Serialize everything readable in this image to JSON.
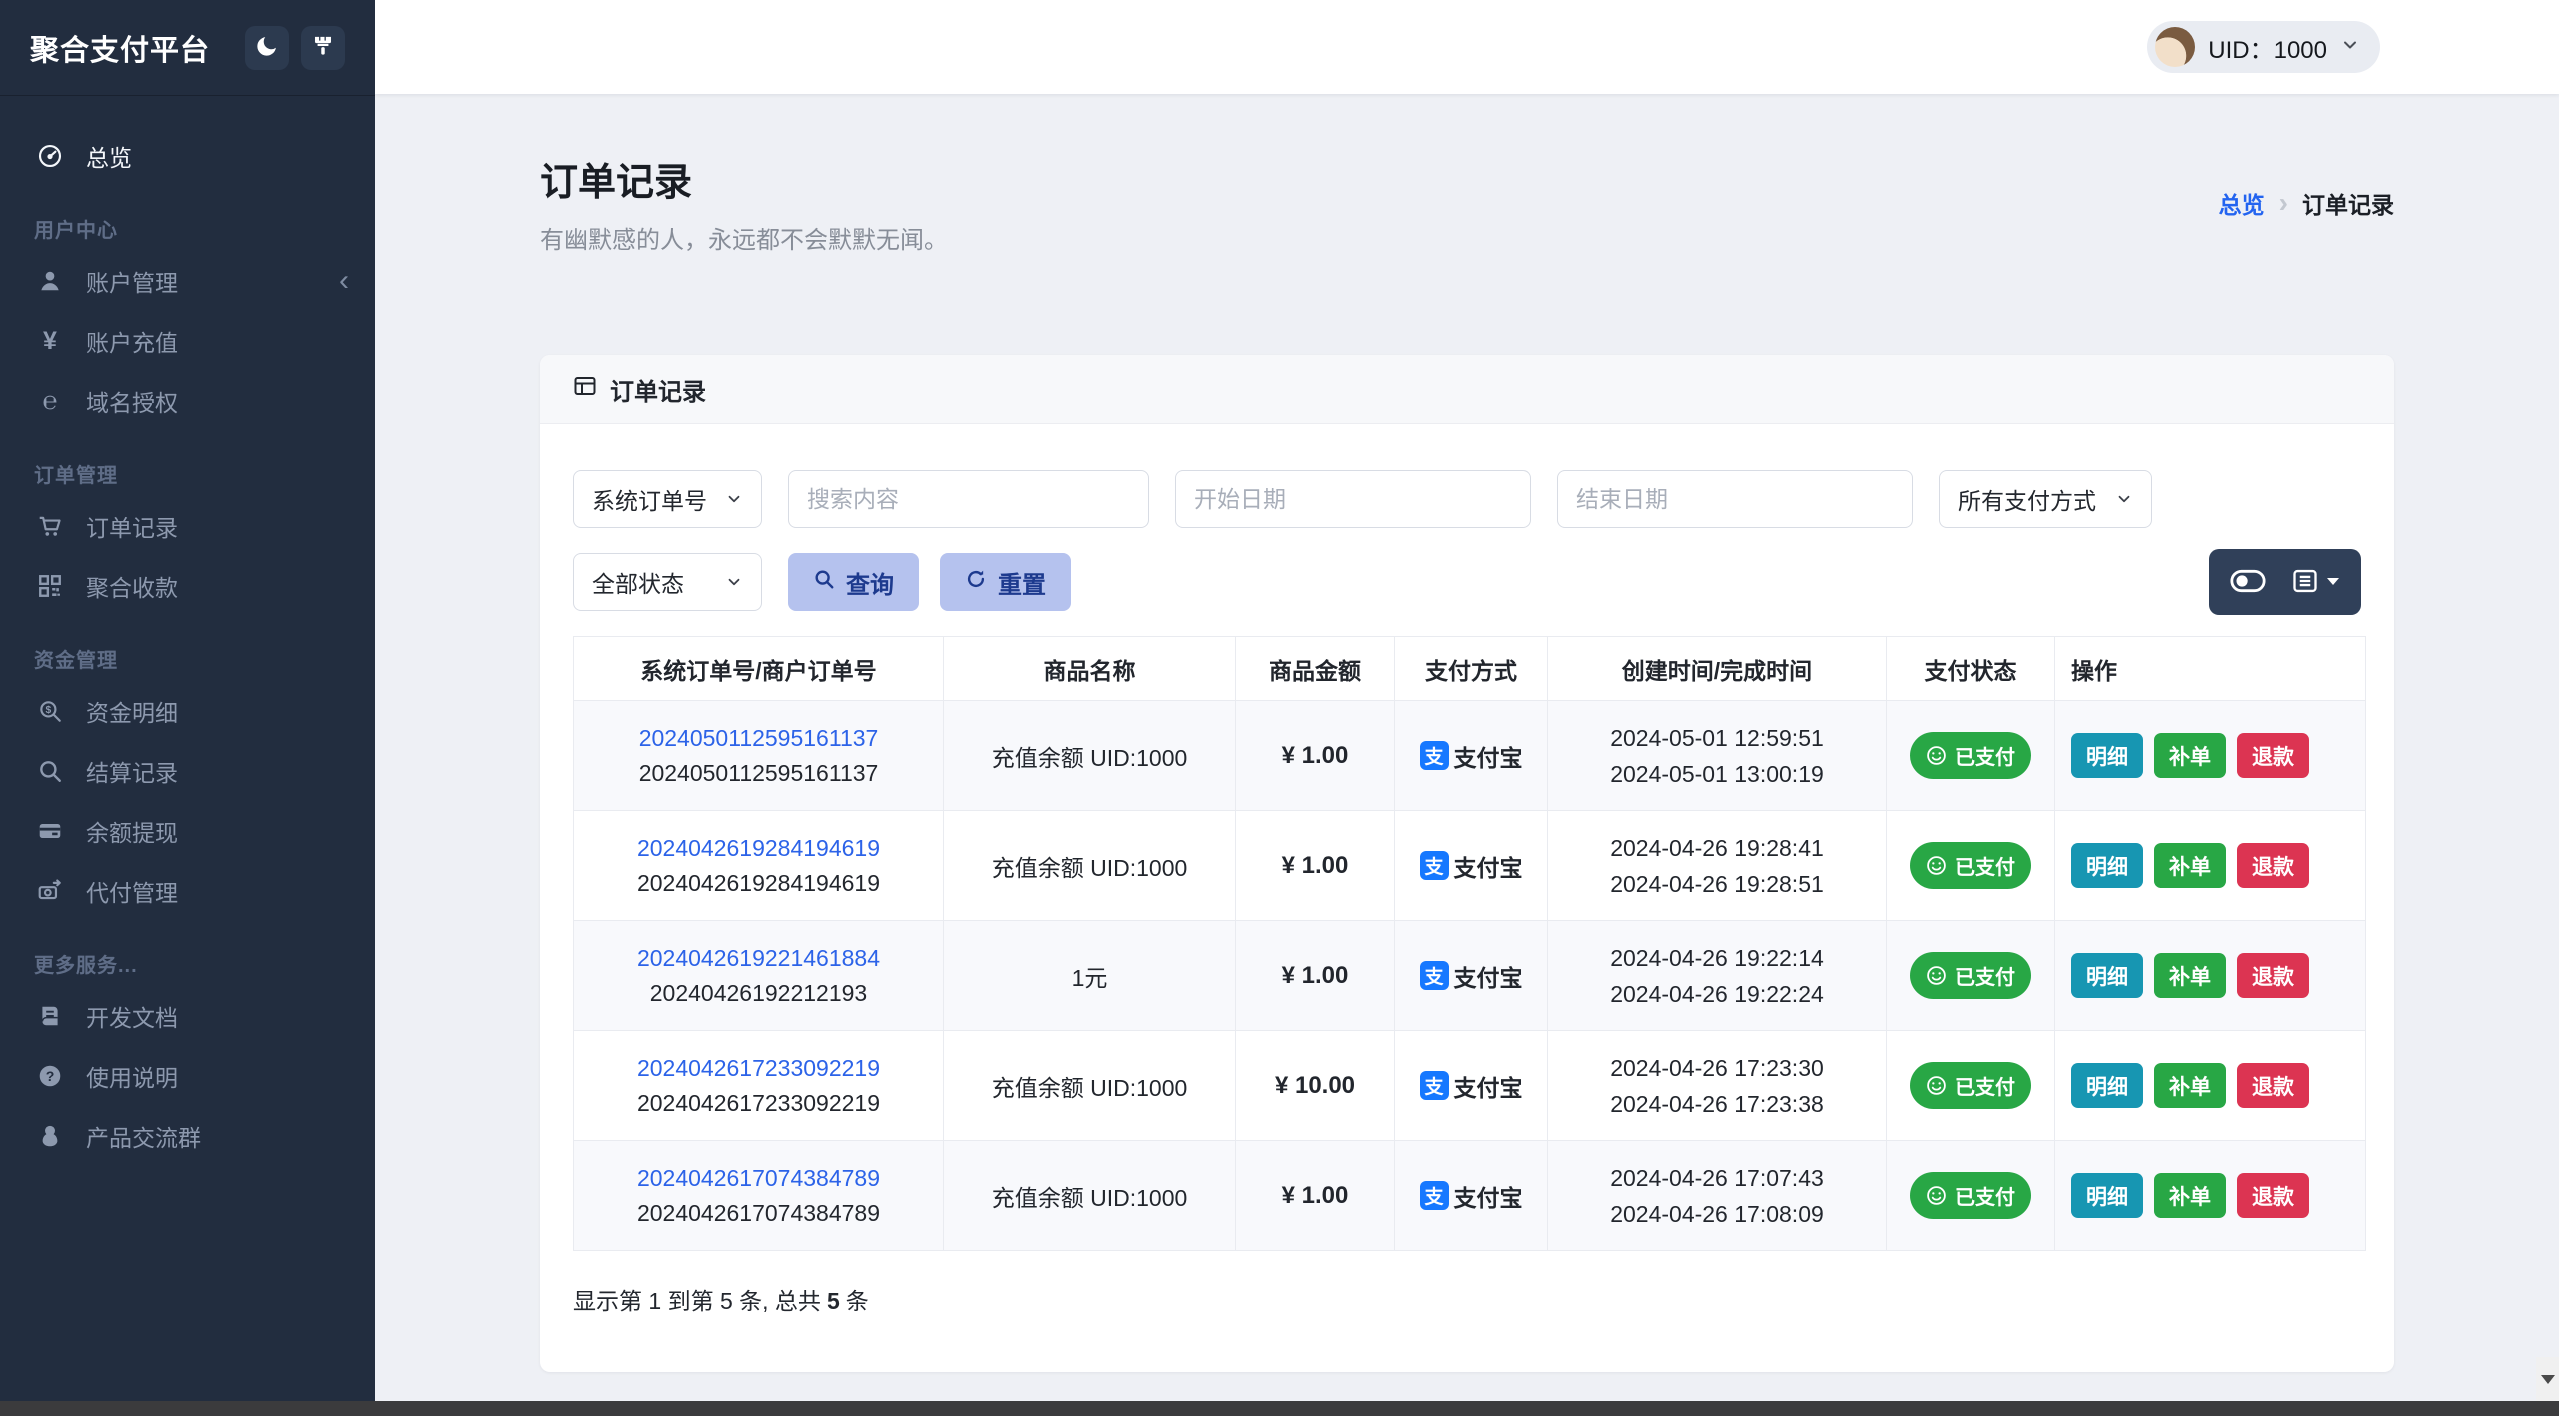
{
  "app": {
    "title": "聚合支付平台"
  },
  "topbar": {
    "uid": "UID：1000"
  },
  "icons": {
    "yen_glyph": "¥",
    "globe_glyph": "℮",
    "alipay_glyph": "支"
  },
  "sidebar": {
    "overview": "总览",
    "sections": [
      {
        "title": "用户中心",
        "items": [
          "账户管理",
          "账户充值",
          "域名授权"
        ]
      },
      {
        "title": "订单管理",
        "items": [
          "订单记录",
          "聚合收款"
        ]
      },
      {
        "title": "资金管理",
        "items": [
          "资金明细",
          "结算记录",
          "余额提现",
          "代付管理"
        ]
      },
      {
        "title": "更多服务...",
        "items": [
          "开发文档",
          "使用说明",
          "产品交流群"
        ]
      }
    ]
  },
  "page": {
    "title": "订单记录",
    "subtitle": "有幽默感的人，永远都不会默默无闻。",
    "breadcrumb": {
      "home": "总览",
      "current": "订单记录"
    }
  },
  "card": {
    "title": "订单记录"
  },
  "filters": {
    "order_type": "系统订单号",
    "search_placeholder": "搜索内容",
    "start_date_placeholder": "开始日期",
    "end_date_placeholder": "结束日期",
    "pay_method": "所有支付方式",
    "status": "全部状态",
    "query": "查询",
    "reset": "重置"
  },
  "table": {
    "columns": [
      "系统订单号/商户订单号",
      "商品名称",
      "商品金额",
      "支付方式",
      "创建时间/完成时间",
      "支付状态",
      "操作"
    ],
    "actions": {
      "detail": "明细",
      "reorder": "补单",
      "refund": "退款"
    }
  },
  "orders": [
    {
      "sys_no": "2024050112595161137",
      "merchant_no": "2024050112595161137",
      "product": "充值余额 UID:1000",
      "amount": "¥ 1.00",
      "pay_method": "支付宝",
      "created": "2024-05-01 12:59:51",
      "completed": "2024-05-01 13:00:19",
      "status": "已支付"
    },
    {
      "sys_no": "2024042619284194619",
      "merchant_no": "2024042619284194619",
      "product": "充值余额 UID:1000",
      "amount": "¥ 1.00",
      "pay_method": "支付宝",
      "created": "2024-04-26 19:28:41",
      "completed": "2024-04-26 19:28:51",
      "status": "已支付"
    },
    {
      "sys_no": "2024042619221461884",
      "merchant_no": "20240426192212193",
      "product": "1元",
      "amount": "¥ 1.00",
      "pay_method": "支付宝",
      "created": "2024-04-26 19:22:14",
      "completed": "2024-04-26 19:22:24",
      "status": "已支付"
    },
    {
      "sys_no": "2024042617233092219",
      "merchant_no": "2024042617233092219",
      "product": "充值余额 UID:1000",
      "amount": "¥ 10.00",
      "pay_method": "支付宝",
      "created": "2024-04-26 17:23:30",
      "completed": "2024-04-26 17:23:38",
      "status": "已支付"
    },
    {
      "sys_no": "2024042617074384789",
      "merchant_no": "2024042617074384789",
      "product": "充值余额 UID:1000",
      "amount": "¥ 1.00",
      "pay_method": "支付宝",
      "created": "2024-04-26 17:07:43",
      "completed": "2024-04-26 17:08:09",
      "status": "已支付"
    }
  ],
  "pagination": {
    "showing": "显示第 1 到第 5 条, 总共",
    "total": "5",
    "unit": "条"
  },
  "colors": {
    "sidebar_bg": "#222d3f",
    "page_bg": "#eef0f5",
    "link": "#2c63e8",
    "success": "#28a745",
    "info": "#1796b2",
    "danger": "#dc3452",
    "alipay": "#1678ff",
    "button_soft": "#b5c2ee",
    "button_soft_text": "#1d3a8e"
  }
}
